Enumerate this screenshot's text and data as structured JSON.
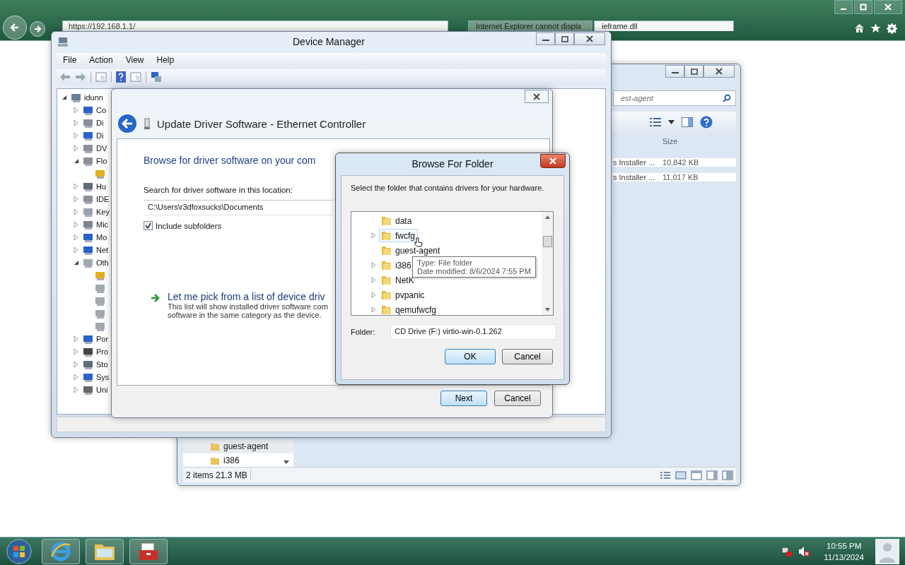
{
  "browser": {
    "address": "https://192.168.1.1/",
    "tabs": [
      {
        "label": "Internet Explorer cannot displa",
        "selected": false
      },
      {
        "label": "ieframe.dll",
        "selected": true
      }
    ]
  },
  "explorer": {
    "search": "est-agent",
    "size_column": "Size",
    "rows": [
      {
        "type": "s Installer ...",
        "size": "10,842 KB"
      },
      {
        "type": "s Installer ...",
        "size": "11,017 KB"
      }
    ],
    "nav": [
      "guest-agent",
      "i386"
    ],
    "status": "2 items 21.3 MB"
  },
  "device_manager": {
    "title": "Device Manager",
    "menu": [
      "File",
      "Action",
      "View",
      "Help"
    ],
    "tree": {
      "label": "idunn",
      "kind": "computer",
      "expanded": true,
      "children": [
        {
          "label": "Co",
          "kind": "monitor",
          "expanded": false
        },
        {
          "label": "Di",
          "kind": "drive",
          "expanded": false
        },
        {
          "label": "Di",
          "kind": "monitor",
          "expanded": false
        },
        {
          "label": "DV",
          "kind": "drive",
          "expanded": false
        },
        {
          "label": "Flo",
          "kind": "drive",
          "expanded": true,
          "children": [
            {
              "kind": "warning"
            }
          ]
        },
        {
          "label": "Hu",
          "kind": "device",
          "expanded": false
        },
        {
          "label": "IDE",
          "kind": "drive",
          "expanded": false
        },
        {
          "label": "Key",
          "kind": "keyboard",
          "expanded": false
        },
        {
          "label": "Mic",
          "kind": "mouse",
          "expanded": false
        },
        {
          "label": "Mo",
          "kind": "monitor",
          "expanded": false
        },
        {
          "label": "Net",
          "kind": "monitor",
          "expanded": false
        },
        {
          "label": "Oth",
          "kind": "unknown",
          "expanded": true,
          "children": [
            {
              "kind": "warning"
            },
            {
              "kind": "unknown"
            },
            {
              "kind": "unknown"
            },
            {
              "kind": "unknown"
            },
            {
              "kind": "unknown"
            }
          ]
        },
        {
          "label": "Por",
          "kind": "monitor",
          "expanded": false
        },
        {
          "label": "Pro",
          "kind": "chip",
          "expanded": false
        },
        {
          "label": "Sto",
          "kind": "device",
          "expanded": false
        },
        {
          "label": "Sys",
          "kind": "monitor",
          "expanded": false
        },
        {
          "label": "Uni",
          "kind": "usb",
          "expanded": false
        }
      ]
    }
  },
  "update_driver": {
    "title": "Update Driver Software - Ethernet Controller",
    "heading": "Browse for driver software on your com",
    "location_label": "Search for driver software in this location:",
    "location": "C:\\Users\\r3dfoxsucks\\Documents",
    "include_subfolders": {
      "label": "Include subfolders",
      "checked": true
    },
    "pick_link": "Let me pick from a list of device driv",
    "pick_desc": [
      "This list will show installed driver software com",
      "software in the same category as the device."
    ],
    "buttons": [
      {
        "label": "Next",
        "default": true
      },
      {
        "label": "Cancel",
        "default": false
      }
    ]
  },
  "browse_folder": {
    "title": "Browse For Folder",
    "instruction": "Select the folder that contains drivers for your hardware.",
    "folders": [
      {
        "label": "data",
        "expandable": false,
        "hovered": false
      },
      {
        "label": "fwcfg",
        "expandable": true,
        "hovered": true
      },
      {
        "label": "guest-agent",
        "expandable": false,
        "hovered": false
      },
      {
        "label": "i386",
        "expandable": true,
        "hovered": false
      },
      {
        "label": "NetK",
        "expandable": true,
        "hovered": false
      },
      {
        "label": "pvpanic",
        "expandable": true,
        "hovered": false
      },
      {
        "label": "qemufwcfg",
        "expandable": true,
        "hovered": false
      }
    ],
    "tooltip": [
      "Type: File folder",
      "Date modified: 8/6/2024 7:55 PM"
    ],
    "folder_label": "Folder:",
    "folder_value": "CD Drive (F:) virtio-win-0.1.262",
    "buttons": [
      {
        "label": "OK",
        "default": true
      },
      {
        "label": "Cancel",
        "default": false
      }
    ]
  },
  "taskbar": {
    "apps": [
      {
        "kind": "browser"
      },
      {
        "kind": "folder"
      },
      {
        "kind": "toolbox"
      }
    ],
    "time": "10:55 PM",
    "date": "11/13/2024"
  }
}
